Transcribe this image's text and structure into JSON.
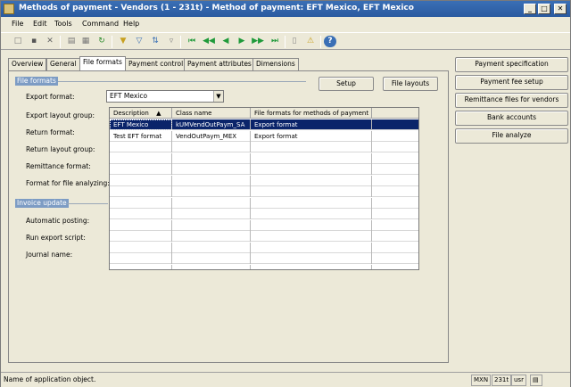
{
  "window": {
    "title": "Methods of payment - Vendors (1 - 231t) - Method of payment: EFT Mexico, EFT Mexico",
    "minimize": "_",
    "maximize": "□",
    "close": "✕"
  },
  "menu": [
    "File",
    "Edit",
    "Tools",
    "Command",
    "Help"
  ],
  "toolbar": [
    {
      "icon": "new-icon",
      "glyph": "□"
    },
    {
      "icon": "save-icon",
      "glyph": "▪"
    },
    {
      "icon": "delete-icon",
      "glyph": "✕"
    },
    {
      "icon": "print-icon",
      "glyph": "▤"
    },
    {
      "icon": "print-preview-icon",
      "glyph": "▦"
    },
    {
      "icon": "refresh-icon",
      "glyph": "↻"
    },
    {
      "icon": "filter-by-selection-icon",
      "glyph": "▼"
    },
    {
      "icon": "advanced-filter-icon",
      "glyph": "▽"
    },
    {
      "icon": "sort-icon",
      "glyph": "⇅"
    },
    {
      "icon": "remove-filter-icon",
      "glyph": "▿"
    },
    {
      "icon": "first-record-icon",
      "glyph": "⏮"
    },
    {
      "icon": "previous-page-icon",
      "glyph": "◀◀"
    },
    {
      "icon": "previous-record-icon",
      "glyph": "◀"
    },
    {
      "icon": "next-record-icon",
      "glyph": "▶"
    },
    {
      "icon": "next-page-icon",
      "glyph": "▶▶"
    },
    {
      "icon": "last-record-icon",
      "glyph": "⏭"
    },
    {
      "icon": "document-handling-icon",
      "glyph": "▯"
    },
    {
      "icon": "alert-icon",
      "glyph": "⚠"
    },
    {
      "icon": "help-icon",
      "glyph": "?"
    }
  ],
  "tabs": [
    {
      "label": "Overview",
      "active": false
    },
    {
      "label": "General",
      "active": false
    },
    {
      "label": "File formats",
      "active": true
    },
    {
      "label": "Payment control",
      "active": false
    },
    {
      "label": "Payment attributes",
      "active": false
    },
    {
      "label": "Dimensions",
      "active": false
    }
  ],
  "file_formats": {
    "group_title": "File formats",
    "export_format_label": "Export format:",
    "export_format_value": "EFT Mexico",
    "export_layout_group_label": "Export layout group:",
    "return_format_label": "Return format:",
    "return_layout_group_label": "Return layout group:",
    "remittance_format_label": "Remittance format:",
    "format_for_file_analyzing_label": "Format for file analyzing:",
    "setup_button": "Setup",
    "file_layouts_button": "File layouts"
  },
  "invoice_update": {
    "group_title": "Invoice update",
    "automatic_posting_label": "Automatic posting:",
    "run_export_script_label": "Run export script:",
    "journal_name_label": "Journal name:"
  },
  "grid": {
    "columns": [
      "Description",
      "Class name",
      "File formats for methods of payment"
    ],
    "sort_indicator": "▲",
    "rows": [
      {
        "description": "EFT Mexico",
        "class_name": "kUMVendOutPaym_SA",
        "file_format": "Export format",
        "selected": true
      },
      {
        "description": "Test EFT format",
        "class_name": "VendOutPaym_MEX",
        "file_format": "Export format",
        "selected": false
      }
    ],
    "empty_rows": 12
  },
  "side_buttons": [
    "Payment specification",
    "Payment fee setup",
    "Remittance files for vendors",
    "Bank accounts",
    "File analyze"
  ],
  "status": {
    "text": "Name of application object.",
    "currency": "MXN",
    "company": "231t",
    "user": "usr"
  }
}
